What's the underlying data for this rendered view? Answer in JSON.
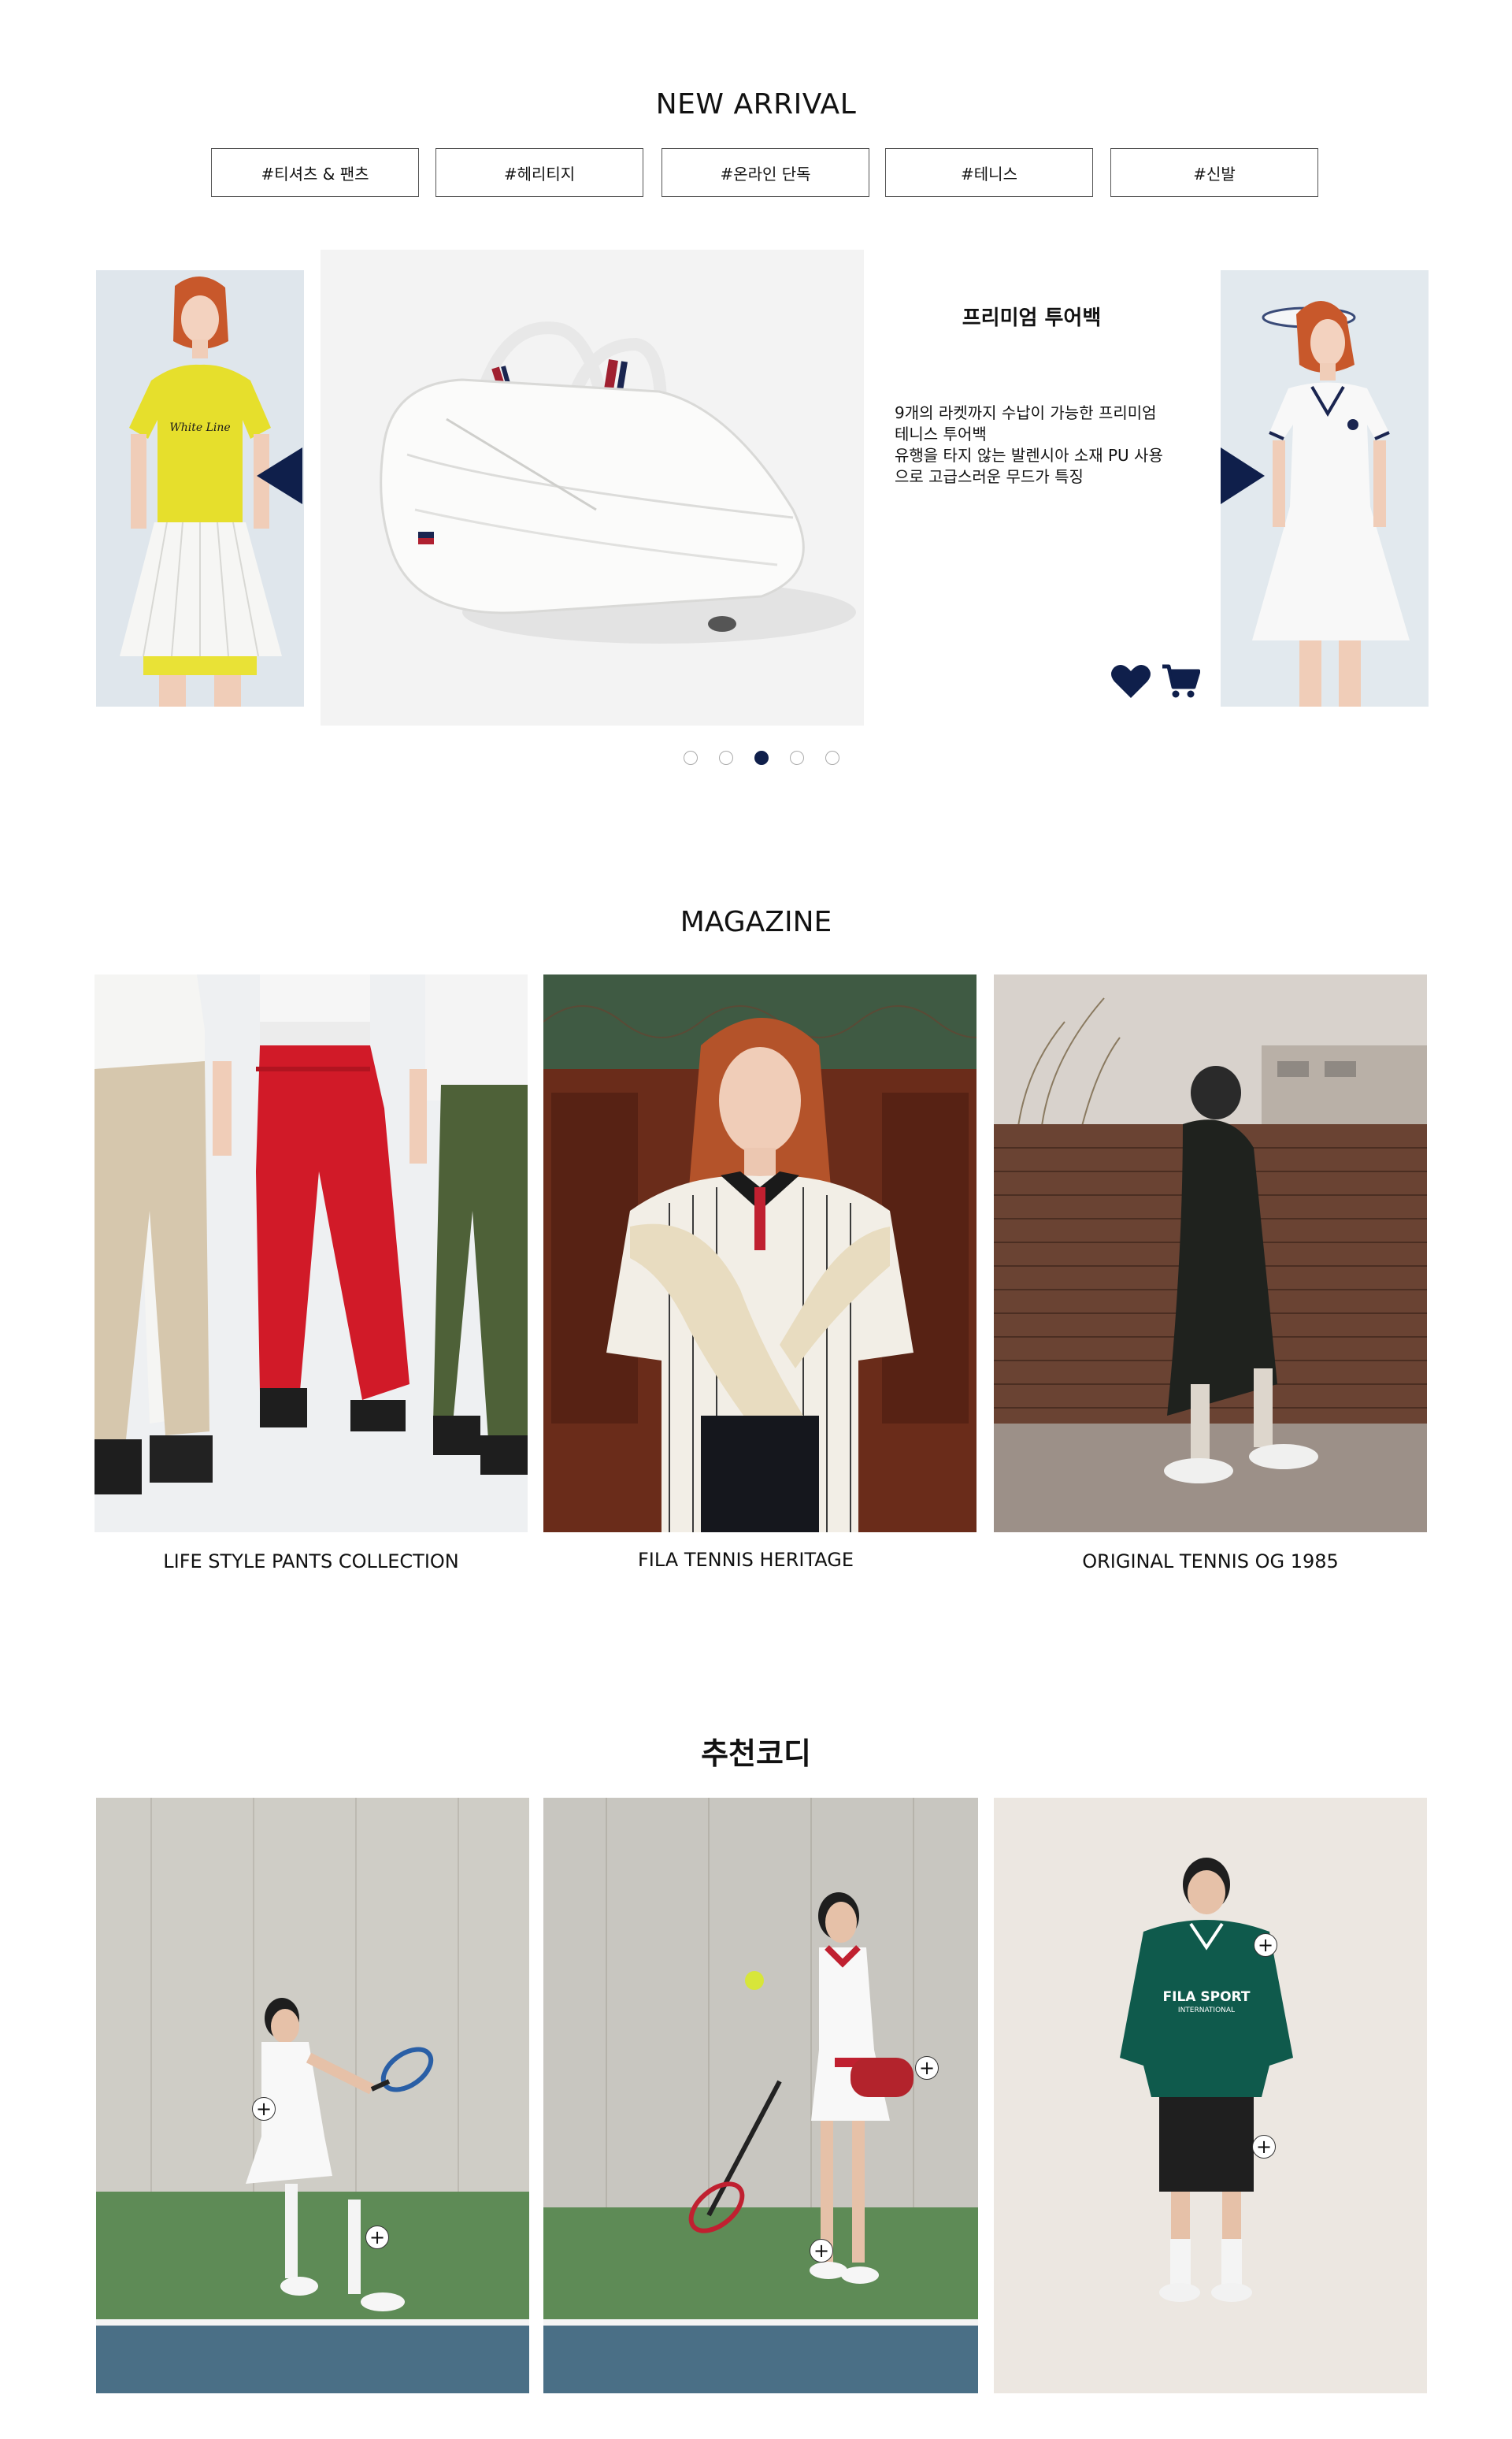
{
  "new_arrival": {
    "title": "NEW ARRIVAL",
    "tags": [
      "#티셔츠 & 팬츠",
      "#헤리티지",
      "#온라인 단독",
      "#테니스",
      "#신발"
    ],
    "product": {
      "title": "프리미엄 투어백",
      "description_lines": [
        "9개의 라켓까지 수납이 가능한 프리미엄",
        "테니스 투어백",
        "유행을 타지 않는 발렌시아 소재 PU 사용",
        "으로 고급스러운 무드가 특징"
      ]
    },
    "slide_count": 5,
    "active_slide": 3,
    "accent_color": "#0f1f4b"
  },
  "magazine": {
    "title": "MAGAZINE",
    "items": [
      {
        "caption": "LIFE STYLE PANTS COLLECTION"
      },
      {
        "caption": "FILA TENNIS HERITAGE"
      },
      {
        "caption": "ORIGINAL TENNIS OG 1985"
      }
    ]
  },
  "codi": {
    "title": "추천코디",
    "sweatshirt_print": [
      "FILA SPORT",
      "INTERNATIONAL"
    ]
  }
}
